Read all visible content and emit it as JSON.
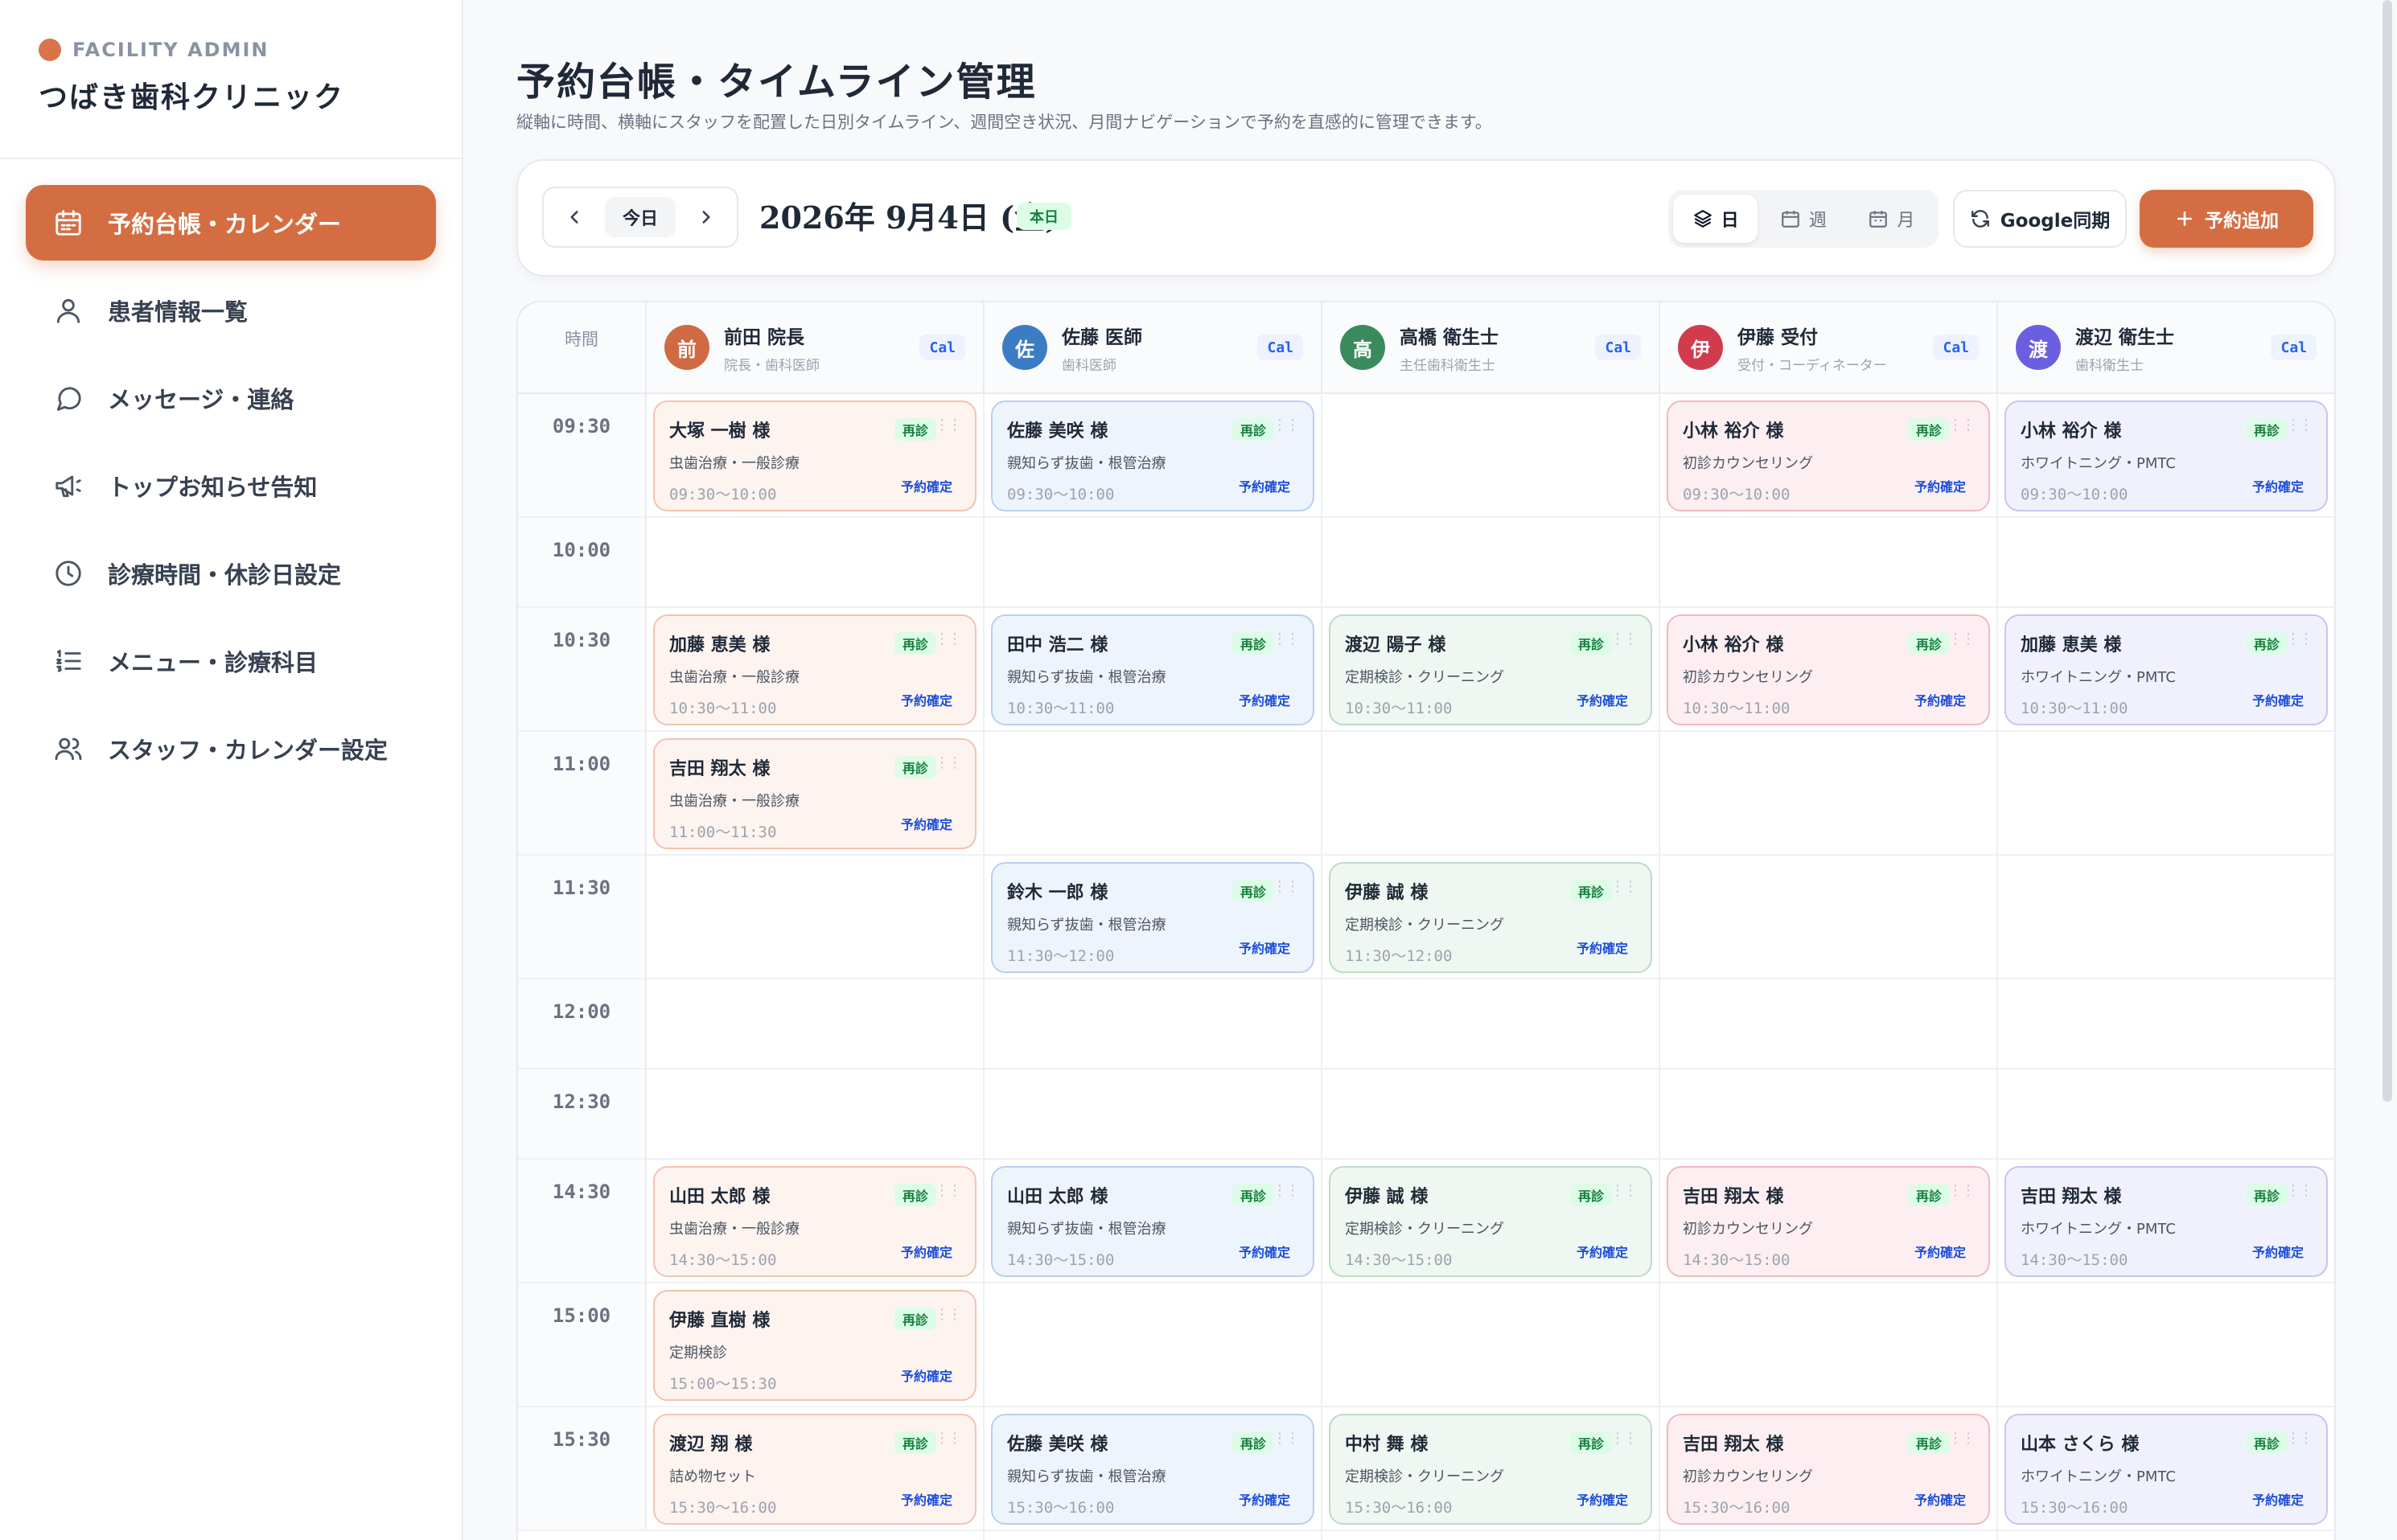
{
  "brand": {
    "label": "FACILITY ADMIN",
    "name": "つばき歯科クリニック",
    "dot_color": "#d9734a"
  },
  "nav": [
    {
      "label": "予約台帳・カレンダー",
      "icon": "calendar-icon",
      "active": true
    },
    {
      "label": "患者情報一覧",
      "icon": "user-icon",
      "active": false
    },
    {
      "label": "メッセージ・連絡",
      "icon": "message-icon",
      "active": false
    },
    {
      "label": "トップお知らせ告知",
      "icon": "megaphone-icon",
      "active": false
    },
    {
      "label": "診療時間・休診日設定",
      "icon": "clock-icon",
      "active": false
    },
    {
      "label": "メニュー・診療科目",
      "icon": "list-icon",
      "active": false
    },
    {
      "label": "スタッフ・カレンダー設定",
      "icon": "users-icon",
      "active": false
    }
  ],
  "page": {
    "title": "予約台帳・タイムライン管理",
    "subtitle": "縦軸に時間、横軸にスタッフを配置した日別タイムライン、週間空き状況、月間ナビゲーションで予約を直感的に管理できます。"
  },
  "toolbar": {
    "today_label": "今日",
    "date_title": "2026年 9月4日 (金)",
    "today_badge": "本日",
    "views": [
      {
        "label": "日",
        "icon": "layers-icon",
        "active": true
      },
      {
        "label": "週",
        "icon": "calendar-week-icon",
        "active": false
      },
      {
        "label": "月",
        "icon": "calendar-month-icon",
        "active": false
      }
    ],
    "google_sync_label": "Google同期",
    "add_label": "予約追加",
    "accent_color": "#d46e42"
  },
  "timeline": {
    "time_header": "時間",
    "cal_label": "Cal",
    "staff": [
      {
        "initial": "前",
        "name": "前田 院長",
        "role": "院長・歯科医師",
        "color": "#cf6a43"
      },
      {
        "initial": "佐",
        "name": "佐藤 医師",
        "role": "歯科医師",
        "color": "#3b7cc4"
      },
      {
        "initial": "高",
        "name": "高橋 衛生士",
        "role": "主任歯科衛生士",
        "color": "#3a8a5c"
      },
      {
        "initial": "伊",
        "name": "伊藤 受付",
        "role": "受付・コーディネーター",
        "color": "#d23b4e"
      },
      {
        "initial": "渡",
        "name": "渡辺 衛生士",
        "role": "歯科衛生士",
        "color": "#6a5fe0"
      }
    ],
    "times": [
      "09:30",
      "10:00",
      "10:30",
      "11:00",
      "11:30",
      "12:00",
      "12:30",
      "14:30",
      "15:00",
      "15:30"
    ],
    "badge_label": "再診",
    "status_label": "予約確定",
    "appointments": [
      {
        "row": 0,
        "col": 0,
        "name": "大塚 一樹 様",
        "treatment": "虫歯治療・一般診療",
        "time": "09:30〜10:00"
      },
      {
        "row": 0,
        "col": 1,
        "name": "佐藤 美咲 様",
        "treatment": "親知らず抜歯・根管治療",
        "time": "09:30〜10:00"
      },
      {
        "row": 0,
        "col": 3,
        "name": "小林 裕介 様",
        "treatment": "初診カウンセリング",
        "time": "09:30〜10:00"
      },
      {
        "row": 0,
        "col": 4,
        "name": "小林 裕介 様",
        "treatment": "ホワイトニング・PMTC",
        "time": "09:30〜10:00"
      },
      {
        "row": 2,
        "col": 0,
        "name": "加藤 恵美 様",
        "treatment": "虫歯治療・一般診療",
        "time": "10:30〜11:00"
      },
      {
        "row": 2,
        "col": 1,
        "name": "田中 浩二 様",
        "treatment": "親知らず抜歯・根管治療",
        "time": "10:30〜11:00"
      },
      {
        "row": 2,
        "col": 2,
        "name": "渡辺 陽子 様",
        "treatment": "定期検診・クリーニング",
        "time": "10:30〜11:00"
      },
      {
        "row": 2,
        "col": 3,
        "name": "小林 裕介 様",
        "treatment": "初診カウンセリング",
        "time": "10:30〜11:00"
      },
      {
        "row": 2,
        "col": 4,
        "name": "加藤 恵美 様",
        "treatment": "ホワイトニング・PMTC",
        "time": "10:30〜11:00"
      },
      {
        "row": 3,
        "col": 0,
        "name": "吉田 翔太 様",
        "treatment": "虫歯治療・一般診療",
        "time": "11:00〜11:30"
      },
      {
        "row": 4,
        "col": 1,
        "name": "鈴木 一郎 様",
        "treatment": "親知らず抜歯・根管治療",
        "time": "11:30〜12:00"
      },
      {
        "row": 4,
        "col": 2,
        "name": "伊藤 誠 様",
        "treatment": "定期検診・クリーニング",
        "time": "11:30〜12:00"
      },
      {
        "row": 7,
        "col": 0,
        "name": "山田 太郎 様",
        "treatment": "虫歯治療・一般診療",
        "time": "14:30〜15:00"
      },
      {
        "row": 7,
        "col": 1,
        "name": "山田 太郎 様",
        "treatment": "親知らず抜歯・根管治療",
        "time": "14:30〜15:00"
      },
      {
        "row": 7,
        "col": 2,
        "name": "伊藤 誠 様",
        "treatment": "定期検診・クリーニング",
        "time": "14:30〜15:00"
      },
      {
        "row": 7,
        "col": 3,
        "name": "吉田 翔太 様",
        "treatment": "初診カウンセリング",
        "time": "14:30〜15:00"
      },
      {
        "row": 7,
        "col": 4,
        "name": "吉田 翔太 様",
        "treatment": "ホワイトニング・PMTC",
        "time": "14:30〜15:00"
      },
      {
        "row": 8,
        "col": 0,
        "name": "伊藤 直樹 様",
        "treatment": "定期検診",
        "time": "15:00〜15:30"
      },
      {
        "row": 9,
        "col": 0,
        "name": "渡辺 翔 様",
        "treatment": "詰め物セット",
        "time": "15:30〜16:00"
      },
      {
        "row": 9,
        "col": 1,
        "name": "佐藤 美咲 様",
        "treatment": "親知らず抜歯・根管治療",
        "time": "15:30〜16:00"
      },
      {
        "row": 9,
        "col": 2,
        "name": "中村 舞 様",
        "treatment": "定期検診・クリーニング",
        "time": "15:30〜16:00"
      },
      {
        "row": 9,
        "col": 3,
        "name": "吉田 翔太 様",
        "treatment": "初診カウンセリング",
        "time": "15:30〜16:00"
      },
      {
        "row": 9,
        "col": 4,
        "name": "山本 さくら 様",
        "treatment": "ホワイトニング・PMTC",
        "time": "15:30〜16:00"
      }
    ]
  }
}
